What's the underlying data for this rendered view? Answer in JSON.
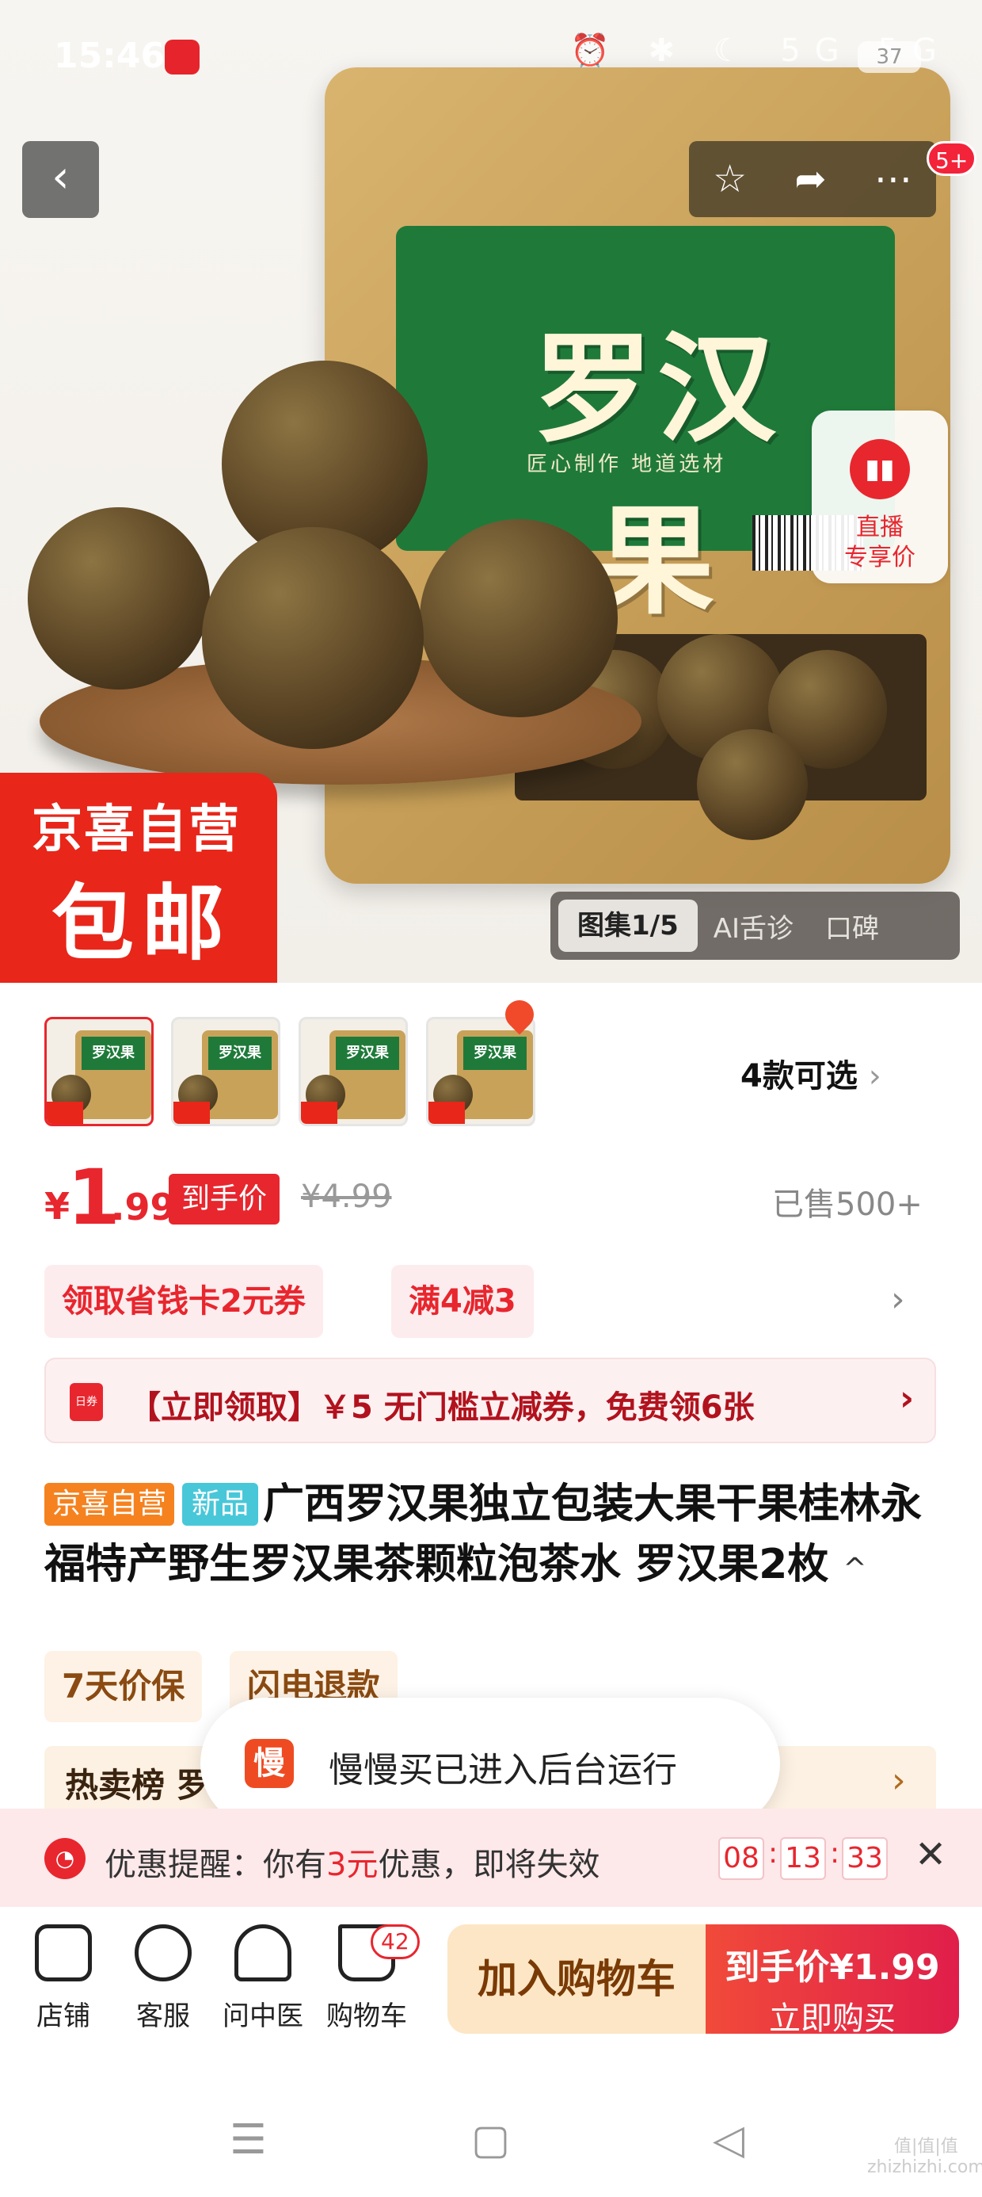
{
  "status_bar": {
    "time": "15:46",
    "icons": "⏰ ✱ ☾ 5G 5G",
    "battery": "37"
  },
  "hero": {
    "bag_title": "罗汉果",
    "bag_subtitle": "匠心制作  地道选材",
    "badge_line1": "京喜自营",
    "badge_line2": "包邮",
    "message_badge": "5+",
    "live_label_line1": "直播",
    "live_label_line2": "专享价",
    "gallery_tabs": [
      "图集1/5",
      "AI舌诊",
      "口碑"
    ]
  },
  "thumbs": {
    "label": "罗汉果",
    "count": 4
  },
  "variants": {
    "label": "4款可选"
  },
  "price": {
    "currency": "¥",
    "integer": "1",
    "decimal": ".99",
    "tag": "到手价",
    "original": "¥4.99",
    "sold": "已售500+"
  },
  "coupons": [
    "领取省钱卡2元券",
    "满4减3"
  ],
  "banner": {
    "text": "【立即领取】￥5 无门槛立减券，免费领6张",
    "icon_text": "日券"
  },
  "product": {
    "tag_jx": "京喜自营",
    "tag_new": "新品",
    "title": "广西罗汉果独立包装大果干果桂林永福特产野生罗汉果茶颗粒泡茶水 罗汉果2枚"
  },
  "services": [
    "7天价保",
    "闪电退款"
  ],
  "hot_list": {
    "label": "热卖榜 罗"
  },
  "toast": {
    "icon_text": "慢",
    "text": "慢慢买已进入后台运行"
  },
  "reminder": {
    "prefix": "优惠提醒：你有",
    "amount": "3元",
    "suffix": "优惠，即将失效",
    "countdown": [
      "08",
      "13",
      "33"
    ]
  },
  "bottom_bar": {
    "items": [
      "店铺",
      "客服",
      "问中医",
      "购物车"
    ],
    "cart_count": "42",
    "add_cart": "加入购物车",
    "buy_line1": "到手价¥1.99",
    "buy_line2": "立即购买"
  },
  "watermark": "值|值|值\nzhizhizhi.com",
  "colors": {
    "accent": "#e8262e",
    "bag_green": "#1f7a3a",
    "bag_gold": "#caa25b"
  }
}
